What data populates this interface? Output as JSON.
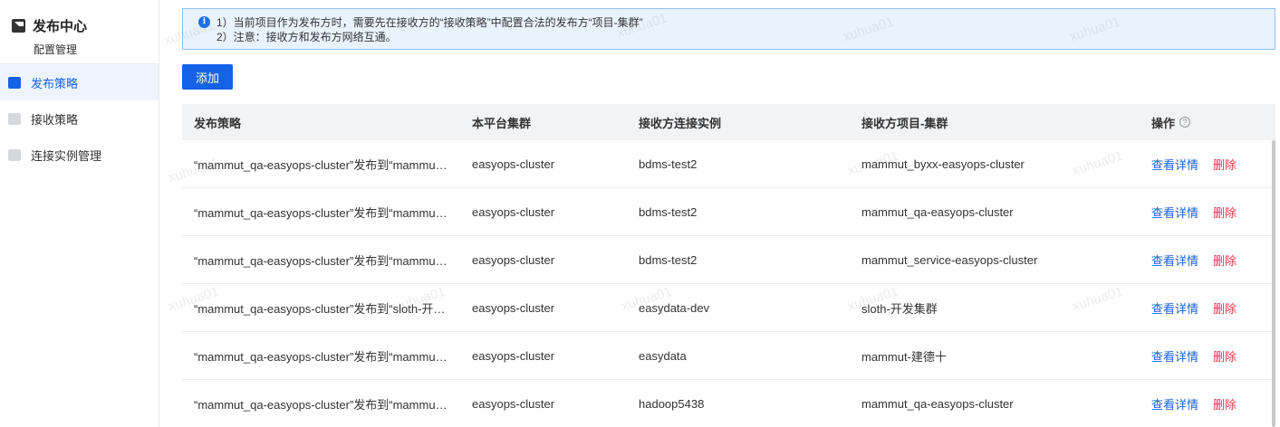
{
  "sidebar": {
    "title": "发布中心",
    "subtitle": "配置管理",
    "items": [
      {
        "label": "发布策略",
        "icon": "publish-icon",
        "active": true
      },
      {
        "label": "接收策略",
        "icon": "receive-icon",
        "active": false
      },
      {
        "label": "连接实例管理",
        "icon": "link-icon",
        "active": false
      }
    ]
  },
  "alert": {
    "icon": "info-icon",
    "line1": "1）当前项目作为发布方时，需要先在接收方的“接收策略”中配置合法的发布方“项目-集群”",
    "line2": "2）注意：接收方和发布方网络互通。"
  },
  "toolbar": {
    "add_label": "添加"
  },
  "table": {
    "columns": [
      "发布策略",
      "本平台集群",
      "接收方连接实例",
      "接收方项目-集群",
      "操作"
    ],
    "rows": [
      {
        "policy": "“mammut_qa-easyops-cluster”发布到“mammut_byxx-easyops-cluster”",
        "cluster": "easyops-cluster",
        "instance": "bdms-test2",
        "target": "mammut_byxx-easyops-cluster",
        "view": "查看详情",
        "delete": "删除"
      },
      {
        "policy": "“mammut_qa-easyops-cluster”发布到“mammut_qa-easyops-cluster”",
        "cluster": "easyops-cluster",
        "instance": "bdms-test2",
        "target": "mammut_qa-easyops-cluster",
        "view": "查看详情",
        "delete": "删除"
      },
      {
        "policy": "“mammut_qa-easyops-cluster”发布到“mammut_service-easyops-cluster”",
        "cluster": "easyops-cluster",
        "instance": "bdms-test2",
        "target": "mammut_service-easyops-cluster",
        "view": "查看详情",
        "delete": "删除"
      },
      {
        "policy": "“mammut_qa-easyops-cluster”发布到“sloth-开发集群”",
        "cluster": "easyops-cluster",
        "instance": "easydata-dev",
        "target": "sloth-开发集群",
        "view": "查看详情",
        "delete": "删除"
      },
      {
        "policy": "“mammut_qa-easyops-cluster”发布到“mammut-建德十”",
        "cluster": "easyops-cluster",
        "instance": "easydata",
        "target": "mammut-建德十",
        "view": "查看详情",
        "delete": "删除"
      },
      {
        "policy": "“mammut_qa-easyops-cluster”发布到“mammut_qa-easyops-cluster”",
        "cluster": "easyops-cluster",
        "instance": "hadoop5438",
        "target": "mammut_qa-easyops-cluster",
        "view": "查看详情",
        "delete": "删除"
      }
    ]
  },
  "watermark": "xuhua01",
  "colors": {
    "accent": "#1662e6",
    "danger": "#e5384a",
    "alert_bg": "#e9f3fe"
  }
}
